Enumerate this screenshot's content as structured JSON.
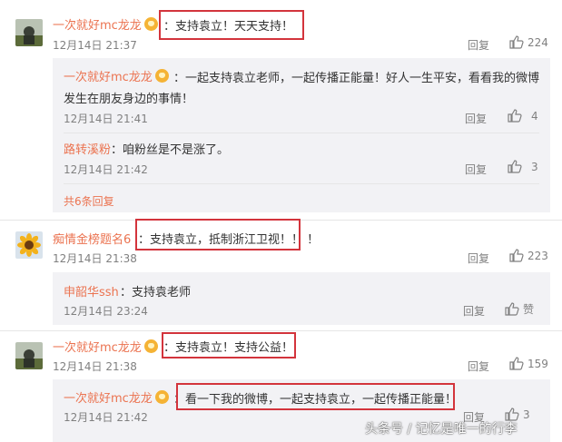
{
  "comments": [
    {
      "user": "一次就好mc龙龙",
      "text": "：支持袁立！天天支持！",
      "date": "12月14日 21:37",
      "reply_label": "回复",
      "likes": "224",
      "replies": [
        {
          "user": "一次就好mc龙龙",
          "text_line1": "：一起支持袁立老师，一起传播正能量！好人一生平安，看看我的微博",
          "text_line2": "发生在朋友身边的事情！",
          "date": "12月14日 21:41",
          "reply_label": "回复",
          "likes": "4"
        },
        {
          "user": "路转溪粉",
          "text": "：咱粉丝是不是涨了。",
          "date": "12月14日 21:42",
          "reply_label": "回复",
          "likes": "3"
        }
      ],
      "more_replies": "共6条回复"
    },
    {
      "user": "痴情金榜题名6",
      "text": "：支持袁立，抵制浙江卫视！！ ！",
      "date": "12月14日 21:38",
      "reply_label": "回复",
      "likes": "223",
      "replies": [
        {
          "user": "申韶华ssh",
          "text": "：支持袁老师",
          "date": "12月14日 23:24",
          "reply_label": "回复",
          "likes": "赞"
        }
      ]
    },
    {
      "user": "一次就好mc龙龙",
      "text": "：支持袁立！支持公益！",
      "date": "12月14日 21:38",
      "reply_label": "回复",
      "likes": "159",
      "replies": [
        {
          "user": "一次就好mc龙龙",
          "text": "：看一下我的微博，一起支持袁立，一起传播正能量！",
          "date": "12月14日 21:42",
          "reply_label": "回复",
          "likes": "3"
        }
      ]
    }
  ],
  "watermark": "头条号 / 记忆是唯一的行李",
  "colors": {
    "username": "#eb7350",
    "highlight_box": "#d3343c",
    "reply_bg": "#f2f2f5"
  }
}
